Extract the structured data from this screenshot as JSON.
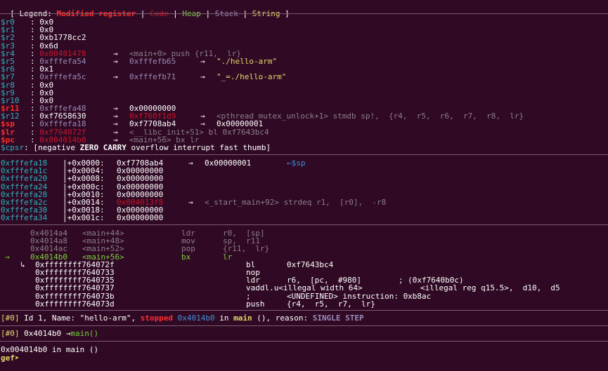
{
  "legend": {
    "open": "[ Legend: ",
    "modified": "Modified register",
    "pipe": " | ",
    "code": "Code",
    "heap": "Heap",
    "stack": "Stack",
    "string": "String",
    "close": " ]"
  },
  "registers": [
    {
      "name": "$r0",
      "value": "0x0"
    },
    {
      "name": "$r1",
      "value": "0x0"
    },
    {
      "name": "$r2",
      "value": "0xb1778cc2"
    },
    {
      "name": "$r3",
      "value": "0x6d"
    },
    {
      "name": "$r4",
      "value": "0x00401478",
      "arrow1": "→",
      "deref1": "<main+0> push {r11,  lr}"
    },
    {
      "name": "$r5",
      "value": "0xfffefa54",
      "arrow1": "→",
      "deref1": "0xfffefb65",
      "arrow2": "→",
      "deref2": "\"./hello-arm\""
    },
    {
      "name": "$r6",
      "value": "0x1"
    },
    {
      "name": "$r7",
      "value": "0xfffefa5c",
      "arrow1": "→",
      "deref1": "0xfffefb71",
      "arrow2": "→",
      "deref2": "\"_=./hello-arm\""
    },
    {
      "name": "$r8",
      "value": "0x0"
    },
    {
      "name": "$r9",
      "value": "0x0"
    },
    {
      "name": "$r10",
      "value": "0x0"
    },
    {
      "name": "$r11",
      "value": "0xfffefa48",
      "arrow1": "→",
      "deref1": "0x00000000"
    },
    {
      "name": "$r12",
      "value": "0xf7658630",
      "arrow1": "→",
      "deref1": "0xf760f1d9",
      "arrow2": "→",
      "deref2": "<pthread_mutex_unlock+1> stmdb sp!,  {r4,  r5,  r6,  r7,  r8,  lr}"
    },
    {
      "name": "$sp",
      "value": "0xfffefa18",
      "arrow1": "→",
      "deref1": "0xf7708ab4",
      "arrow2": "→",
      "deref2": "0x00000001"
    },
    {
      "name": "$lr",
      "value": "0xf764072f",
      "arrow1": "→",
      "deref1": "<__libc_init+51> bl 0xf7643bc4"
    },
    {
      "name": "$pc",
      "value": "0x004014b0",
      "arrow1": "→",
      "deref1": "<main+56> bx lr"
    },
    {
      "name": "$cpsr",
      "sep": ": ",
      "open": "[",
      "neg": "negative ",
      "zero": "ZERO",
      "sp1": " ",
      "carry": "CARRY",
      "rest": " overflow interrupt fast thumb]"
    }
  ],
  "stack": [
    {
      "addr": "0xfffefa18",
      "off": "+0x0000:",
      "val": "0xf7708ab4",
      "arrow": "→",
      "deref": "0x00000001",
      "marker": "←$sp"
    },
    {
      "addr": "0xfffefa1c",
      "off": "+0x0004:",
      "val": "0x00000000"
    },
    {
      "addr": "0xfffefa20",
      "off": "+0x0008:",
      "val": "0x00000000"
    },
    {
      "addr": "0xfffefa24",
      "off": "+0x000c:",
      "val": "0x00000000"
    },
    {
      "addr": "0xfffefa28",
      "off": "+0x0010:",
      "val": "0x00000000"
    },
    {
      "addr": "0xfffefa2c",
      "off": "+0x0014:",
      "val": "0x004013f8",
      "arrow": "→",
      "deref": "<_start_main+92> strdeq r1,  [r0],  -r8"
    },
    {
      "addr": "0xfffefa30",
      "off": "+0x0018:",
      "val": "0x00000000"
    },
    {
      "addr": "0xfffefa34",
      "off": "+0x001c:",
      "val": "0x00000000"
    }
  ],
  "code": [
    {
      "prefix": "",
      "addr": "0x4014a4",
      "sym": "<main+44>",
      "mn": "ldr",
      "ops": "r0,  [sp]"
    },
    {
      "prefix": "",
      "addr": "0x4014a8",
      "sym": "<main+48>",
      "mn": "mov",
      "ops": "sp,  r11"
    },
    {
      "prefix": "",
      "addr": "0x4014ac",
      "sym": "<main+52>",
      "mn": "pop",
      "ops": "{r11,  lr}"
    },
    {
      "prefix": "→",
      "addr": "0x4014b0",
      "sym": "<main+56>",
      "mn": "bx",
      "ops": "lr"
    }
  ],
  "branch": [
    {
      "prefix": "↳",
      "addr": "0xffffffff764072f",
      "mn": "bl",
      "ops": "0xf7643bc4"
    },
    {
      "prefix": "",
      "addr": "0xffffffff7640733",
      "mn": "nop",
      "ops": ""
    },
    {
      "prefix": "",
      "addr": "0xffffffff7640735",
      "mn": "ldr",
      "ops": "r6,  [pc,  #980]        ; (0xf7640b0c)"
    },
    {
      "prefix": "",
      "addr": "0xffffffff7640737",
      "mn": "vaddl.u<illegal width 64>",
      "ops": "<illegal reg q15.5>,  d10,  d5"
    },
    {
      "prefix": "",
      "addr": "0xffffffff764073b",
      "mn": ";",
      "ops": "<UNDEFINED> instruction: 0xb8ac"
    },
    {
      "prefix": "",
      "addr": "0xffffffff764073d",
      "mn": "push",
      "ops": "{r4,  r5,  r7,  lr}"
    }
  ],
  "threads": {
    "id": "[#0]",
    "text1": " Id 1, Name: \"hello-arm\", ",
    "state": "stopped",
    "addr": " 0x4014b0",
    "in": " in ",
    "func": "main",
    "text2": " (), reason: ",
    "reason": "SINGLE STEP"
  },
  "trace": {
    "id": "[#0]",
    "addr": " 0x4014b0",
    "arrow": " →",
    "func": "main()"
  },
  "output": "0x004014b0 in main ()",
  "prompt": "gef➤"
}
